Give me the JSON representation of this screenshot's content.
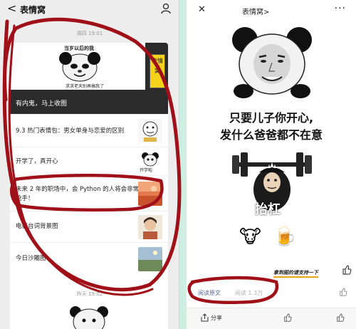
{
  "left": {
    "nav": {
      "back_glyph": "<",
      "title": "表情窝",
      "person_icon": "person-icon"
    },
    "time_top": "周四 19:01",
    "hero": {
      "top_text": "当岁以后的我",
      "bottom_text": "求求老天别再搞我了",
      "tag": "表情窝",
      "caption": "有内鬼，马上收图"
    },
    "articles": [
      {
        "title": "9.3 热门表情包：男女单身与恋爱的区别"
      },
      {
        "title": "开学了，真开心",
        "thumb_label": "开学啦"
      },
      {
        "title": "未来 2 年的职场中，会 Python 的人将会非常抢手！"
      },
      {
        "title": "电影台词背景图"
      },
      {
        "title": "今日沙雕图"
      }
    ],
    "time_bottom": "昨天 19:02"
  },
  "right": {
    "close_glyph": "✕",
    "title": "表情窝>",
    "more_glyph": "···",
    "caption_line1": "只要儿子你开心,",
    "caption_line2": "发什么爸爸都不在意",
    "meme_label": "抬杠",
    "emoji_cow": "🐮",
    "emoji_beer": "🍺",
    "note": "拿到图的请支持一下",
    "read_original": "阅读原文",
    "views": "阅读 1.3万",
    "share": "分享"
  },
  "colors": {
    "annotation": "#a01018",
    "link": "#576b95",
    "tag_yellow": "#f5d21c"
  }
}
